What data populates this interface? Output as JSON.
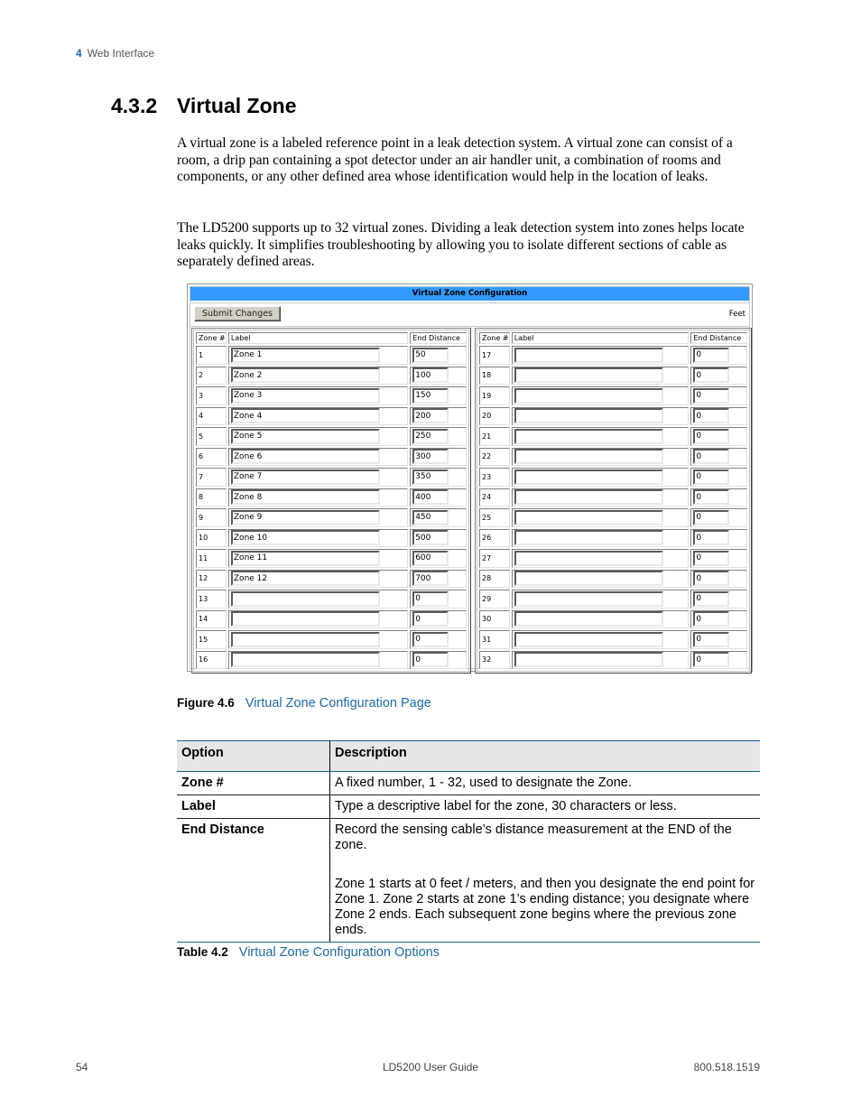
{
  "running_head": {
    "chapter": "4",
    "title": "Web Interface"
  },
  "section": {
    "number": "4.3.2",
    "title": "Virtual Zone"
  },
  "paragraphs": [
    "A virtual zone is a labeled reference point in a leak detection system. A virtual zone can consist of a room, a drip pan containing a spot detector under an air handler unit, a combination of rooms and components, or any other defined area whose identification would help in the location of leaks.",
    "The LD5200 supports up to 32 virtual zones. Dividing a leak detection system into zones helps locate leaks quickly. It simplifies troubleshooting by allowing you to isolate different sections of cable as separately defined areas."
  ],
  "screenshot": {
    "title": "Virtual Zone Configuration",
    "submit_label": "Submit Changes",
    "units": "Feet",
    "header_color": "#3399ff",
    "columns": {
      "zone": "Zone #",
      "label": "Label",
      "end_distance": "End Distance"
    },
    "left_zones": [
      {
        "zone": "1",
        "label": "Zone 1",
        "end": "50"
      },
      {
        "zone": "2",
        "label": "Zone 2",
        "end": "100"
      },
      {
        "zone": "3",
        "label": "Zone 3",
        "end": "150"
      },
      {
        "zone": "4",
        "label": "Zone 4",
        "end": "200"
      },
      {
        "zone": "5",
        "label": "Zone 5",
        "end": "250"
      },
      {
        "zone": "6",
        "label": "Zone 6",
        "end": "300"
      },
      {
        "zone": "7",
        "label": "Zone 7",
        "end": "350"
      },
      {
        "zone": "8",
        "label": "Zone 8",
        "end": "400"
      },
      {
        "zone": "9",
        "label": "Zone 9",
        "end": "450"
      },
      {
        "zone": "10",
        "label": "Zone 10",
        "end": "500"
      },
      {
        "zone": "11",
        "label": "Zone 11",
        "end": "600"
      },
      {
        "zone": "12",
        "label": "Zone 12",
        "end": "700"
      },
      {
        "zone": "13",
        "label": "",
        "end": "0"
      },
      {
        "zone": "14",
        "label": "",
        "end": "0"
      },
      {
        "zone": "15",
        "label": "",
        "end": "0"
      },
      {
        "zone": "16",
        "label": "",
        "end": "0"
      }
    ],
    "right_zones": [
      {
        "zone": "17",
        "label": "",
        "end": "0"
      },
      {
        "zone": "18",
        "label": "",
        "end": "0"
      },
      {
        "zone": "19",
        "label": "",
        "end": "0"
      },
      {
        "zone": "20",
        "label": "",
        "end": "0"
      },
      {
        "zone": "21",
        "label": "",
        "end": "0"
      },
      {
        "zone": "22",
        "label": "",
        "end": "0"
      },
      {
        "zone": "23",
        "label": "",
        "end": "0"
      },
      {
        "zone": "24",
        "label": "",
        "end": "0"
      },
      {
        "zone": "25",
        "label": "",
        "end": "0"
      },
      {
        "zone": "26",
        "label": "",
        "end": "0"
      },
      {
        "zone": "27",
        "label": "",
        "end": "0"
      },
      {
        "zone": "28",
        "label": "",
        "end": "0"
      },
      {
        "zone": "29",
        "label": "",
        "end": "0"
      },
      {
        "zone": "30",
        "label": "",
        "end": "0"
      },
      {
        "zone": "31",
        "label": "",
        "end": "0"
      },
      {
        "zone": "32",
        "label": "",
        "end": "0"
      }
    ]
  },
  "figure_caption": {
    "tag": "Figure 4.6",
    "text": "Virtual Zone Configuration Page"
  },
  "options_table": {
    "headers": [
      "Option",
      "Description"
    ],
    "rows": [
      {
        "option": "Zone #",
        "description": [
          "A fixed number, 1 - 32, used to designate the Zone."
        ]
      },
      {
        "option": "Label",
        "description": [
          "Type a descriptive label for the zone, 30 characters or less."
        ]
      },
      {
        "option": "End Distance",
        "description": [
          "Record the sensing cable’s distance measurement at the END of the zone.",
          "Zone 1 starts at 0 feet / meters, and then you designate the end point for Zone 1. Zone 2 starts at zone 1’s ending distance; you designate where Zone 2 ends. Each subsequent zone begins where the previous zone ends."
        ]
      }
    ]
  },
  "table_caption": {
    "tag": "Table 4.2",
    "text": "Virtual Zone Configuration Options"
  },
  "footer": {
    "page": "54",
    "doc": "LD5200 User Guide",
    "phone": "800.518.1519"
  },
  "colors": {
    "accent_blue": "#1f6aa0",
    "table_rule": "#1f5f8b",
    "header_bg": "#e6e6e6"
  }
}
